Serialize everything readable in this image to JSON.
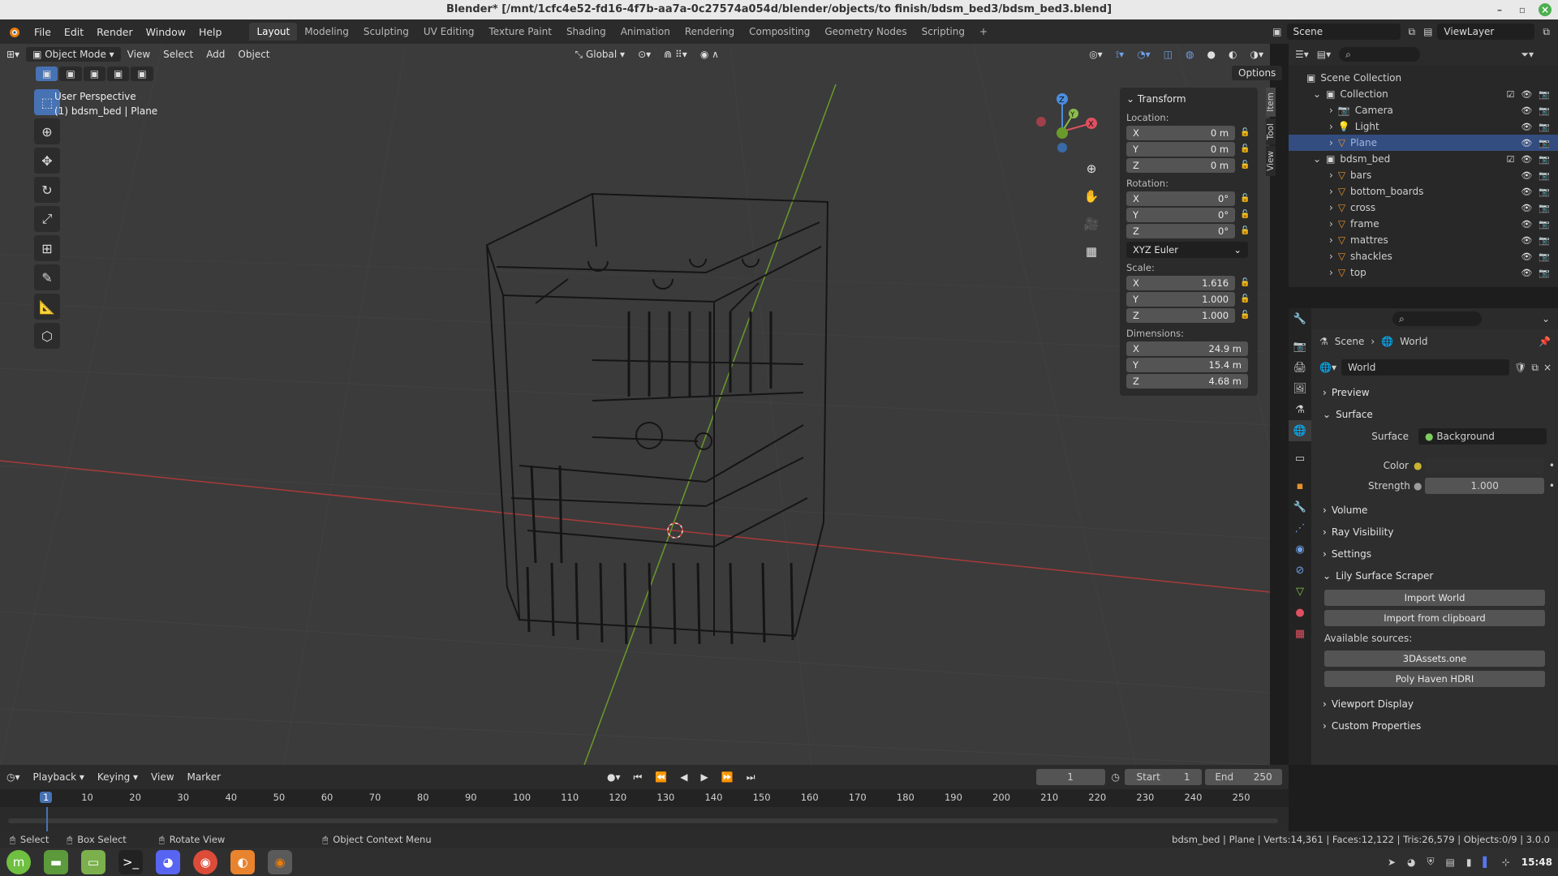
{
  "window": {
    "title": "Blender* [/mnt/1cfc4e52-fd16-4f7b-aa7a-0c27574a054d/blender/objects/to finish/bdsm_bed3/bdsm_bed3.blend]"
  },
  "menu": {
    "items": [
      "File",
      "Edit",
      "Render",
      "Window",
      "Help"
    ]
  },
  "workspaces": {
    "tabs": [
      "Layout",
      "Modeling",
      "Sculpting",
      "UV Editing",
      "Texture Paint",
      "Shading",
      "Animation",
      "Rendering",
      "Compositing",
      "Geometry Nodes",
      "Scripting"
    ],
    "add": "+"
  },
  "scene": {
    "name": "Scene",
    "view_layer": "ViewLayer"
  },
  "viewport": {
    "mode": "Object Mode",
    "menus": [
      "View",
      "Select",
      "Add",
      "Object"
    ],
    "orientation": "Global",
    "options": "Options",
    "info_line1": "User Perspective",
    "info_line2": "(1) bdsm_bed | Plane"
  },
  "npanel": {
    "title": "Transform",
    "tabs": [
      "Item",
      "Tool",
      "View"
    ],
    "location": {
      "label": "Location:",
      "x": "0 m",
      "y": "0 m",
      "z": "0 m"
    },
    "rotation": {
      "label": "Rotation:",
      "x": "0°",
      "y": "0°",
      "z": "0°",
      "mode": "XYZ Euler"
    },
    "scale": {
      "label": "Scale:",
      "x": "1.616",
      "y": "1.000",
      "z": "1.000"
    },
    "dimensions": {
      "label": "Dimensions:",
      "x": "24.9 m",
      "y": "15.4 m",
      "z": "4.68 m"
    },
    "axis": {
      "x": "X",
      "y": "Y",
      "z": "Z"
    }
  },
  "outliner": {
    "root": "Scene Collection",
    "rows": [
      {
        "label": "Collection",
        "indent": 1,
        "type": "collection"
      },
      {
        "label": "Camera",
        "indent": 2,
        "type": "camera"
      },
      {
        "label": "Light",
        "indent": 2,
        "type": "light"
      },
      {
        "label": "Plane",
        "indent": 2,
        "type": "mesh",
        "selected": true
      },
      {
        "label": "bdsm_bed",
        "indent": 1,
        "type": "collection"
      },
      {
        "label": "bars",
        "indent": 2,
        "type": "mesh"
      },
      {
        "label": "bottom_boards",
        "indent": 2,
        "type": "mesh"
      },
      {
        "label": "cross",
        "indent": 2,
        "type": "mesh"
      },
      {
        "label": "frame",
        "indent": 2,
        "type": "mesh"
      },
      {
        "label": "mattres",
        "indent": 2,
        "type": "mesh"
      },
      {
        "label": "shackles",
        "indent": 2,
        "type": "mesh"
      },
      {
        "label": "top",
        "indent": 2,
        "type": "mesh"
      }
    ]
  },
  "properties": {
    "breadcrumb_scene": "Scene",
    "breadcrumb_world": "World",
    "world_name": "World",
    "sections": {
      "preview": "Preview",
      "surface": "Surface",
      "volume": "Volume",
      "ray_visibility": "Ray Visibility",
      "settings": "Settings",
      "lily": "Lily Surface Scraper",
      "viewport_display": "Viewport Display",
      "custom_props": "Custom Properties"
    },
    "surface_label": "Surface",
    "surface_value": "Background",
    "color_label": "Color",
    "strength_label": "Strength",
    "strength_value": "1.000",
    "import_world": "Import World",
    "import_clipboard": "Import from clipboard",
    "available_sources": "Available sources:",
    "source_1": "3DAssets.one",
    "source_2": "Poly Haven HDRI"
  },
  "timeline": {
    "menus": [
      "Playback",
      "Keying",
      "View",
      "Marker"
    ],
    "current_frame": "1",
    "start_label": "Start",
    "start": "1",
    "end_label": "End",
    "end": "250",
    "ticks": [
      "1",
      "10",
      "20",
      "30",
      "40",
      "50",
      "60",
      "70",
      "80",
      "90",
      "100",
      "110",
      "120",
      "130",
      "140",
      "150",
      "160",
      "170",
      "180",
      "190",
      "200",
      "210",
      "220",
      "230",
      "240",
      "250"
    ]
  },
  "status_bar": {
    "select": "Select",
    "box_select": "Box Select",
    "rotate_view": "Rotate View",
    "context_menu": "Object Context Menu",
    "stats": "bdsm_bed | Plane | Verts:14,361 | Faces:12,122 | Tris:26,579 | Objects:0/9 | 3.0.0"
  },
  "taskbar": {
    "clock": "15:48"
  },
  "colors": {
    "accent": "#4772b3",
    "selected_row": "#334d80",
    "x_axis": "#e05060",
    "y_axis": "#8cbd4b",
    "z_axis": "#4b8ee0"
  }
}
